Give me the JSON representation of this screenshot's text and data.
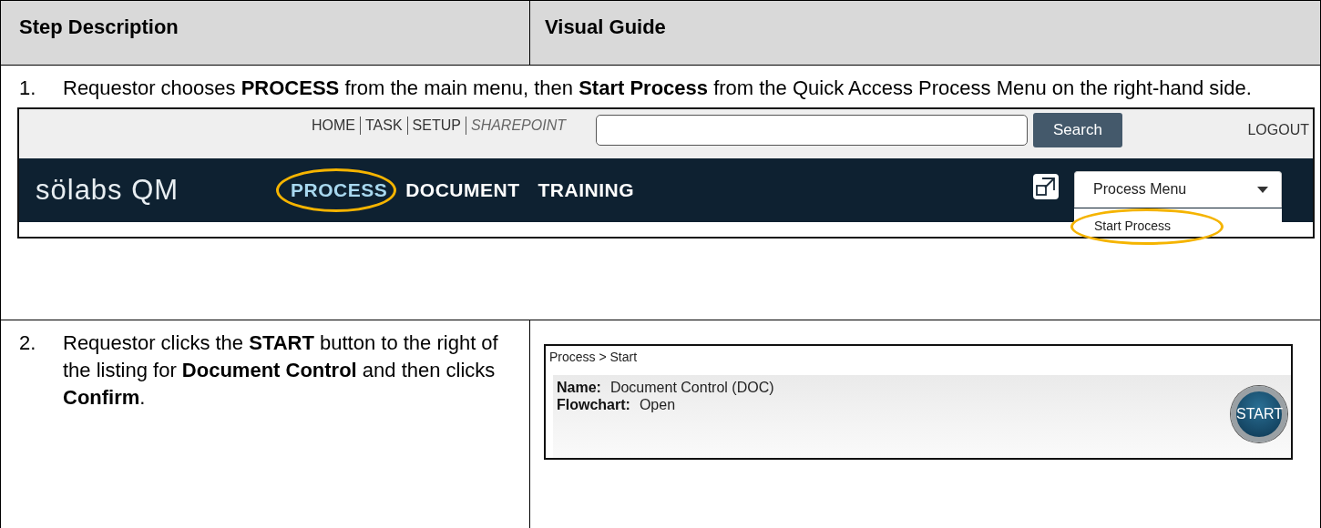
{
  "table": {
    "columns": [
      "Step Description",
      "Visual Guide"
    ]
  },
  "step_1": {
    "number": "1.",
    "text": "Requestor chooses **PROCESS** from the main menu, then **Start Process** from the Quick Access Process Menu on the right-hand side.",
    "app_screenshot": {
      "top_links": [
        {
          "label": "HOME",
          "italic": false
        },
        {
          "label": "TASK",
          "italic": false
        },
        {
          "label": "SETUP",
          "italic": false
        },
        {
          "label": "SHAREPOINT",
          "italic": true
        }
      ],
      "search_button": "Search",
      "logout": "LOGOUT",
      "logo": "sölabs QM",
      "nav": [
        {
          "label": "PROCESS",
          "selected": true,
          "highlighted": true
        },
        {
          "label": "DOCUMENT",
          "selected": false,
          "highlighted": false
        },
        {
          "label": "TRAINING",
          "selected": false,
          "highlighted": false
        }
      ],
      "process_menu": {
        "label": "Process Menu",
        "expanded": true,
        "options": [
          {
            "label": "Start Process",
            "highlighted": true
          }
        ]
      }
    }
  },
  "step_2": {
    "number": "2.",
    "text": "Requestor clicks the **START** button to the right of the listing for **Document Control** and then clicks **Confirm**.",
    "app_screenshot": {
      "breadcrumb": "Process > Start",
      "fields": [
        {
          "label": "Name:",
          "value": "Document Control (DOC)"
        },
        {
          "label": "Flowchart:",
          "value": "Open"
        }
      ],
      "start_button": "START"
    }
  }
}
